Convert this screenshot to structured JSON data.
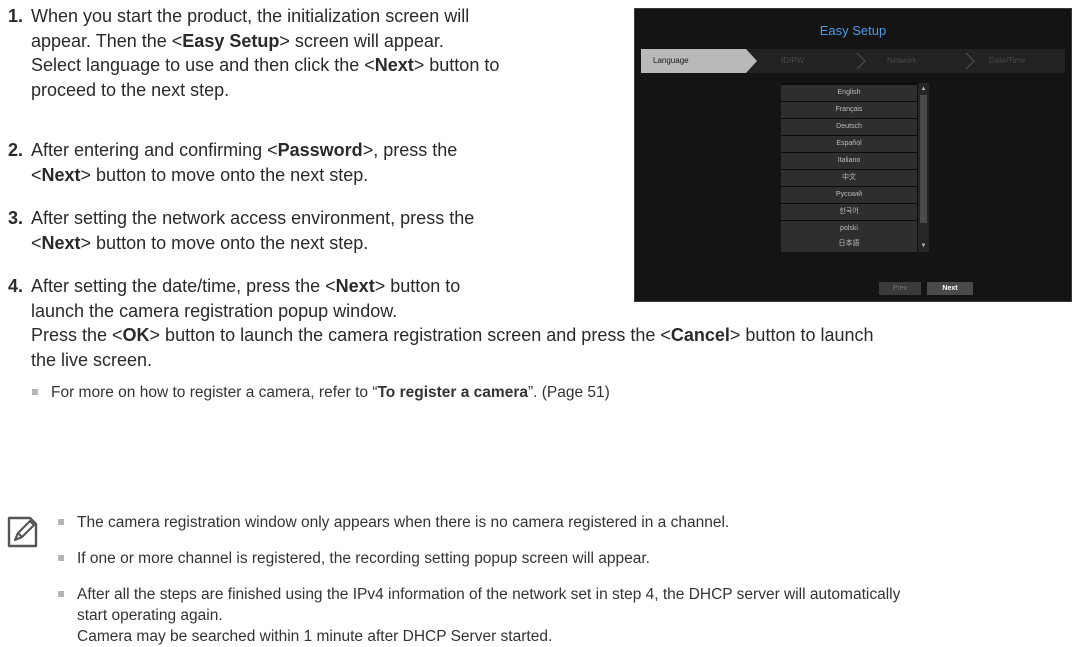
{
  "steps": [
    {
      "num": "1.",
      "lines": [
        {
          "t1": "When you start the product, the initialization screen will"
        },
        {
          "t1": "appear. Then the <",
          "b1": "Easy Setup",
          "t2": "> screen will appear."
        },
        {
          "t1": "Select language to use and then click the <",
          "b1": "Next",
          "t2": "> button to"
        },
        {
          "t1": "proceed to the next step."
        }
      ]
    },
    {
      "num": "2.",
      "lines": [
        {
          "t1": "After entering and confirming <",
          "b1": "Password",
          "t2": ">, press the"
        },
        {
          "t1": "<",
          "b1": "Next",
          "t2": "> button to move onto the next step."
        }
      ]
    },
    {
      "num": "3.",
      "lines": [
        {
          "t1": "After setting the network access environment, press the"
        },
        {
          "t1": "<",
          "b1": "Next",
          "t2": "> button to move onto the next step."
        }
      ]
    },
    {
      "num": "4.",
      "lines": [
        {
          "t1": "After setting the date/time, press the <",
          "b1": "Next",
          "t2": "> button to"
        },
        {
          "t1": "launch the camera registration popup window."
        },
        {
          "t1": "Press the <",
          "b1": "OK",
          "t2": "> button to launch the camera registration screen and press the <",
          "b2": "Cancel",
          "t3": "> button to launch"
        },
        {
          "t1": "the live screen."
        }
      ]
    }
  ],
  "tip": {
    "t1": "For more on how to register a camera, refer to “",
    "b1": "To register a camera",
    "t2": "”. (Page 51)"
  },
  "notes": [
    {
      "lines": [
        "The camera registration window only appears when there is no camera registered in a channel."
      ]
    },
    {
      "lines": [
        "If one or more channel is registered, the recording setting popup screen will appear."
      ]
    },
    {
      "lines": [
        "After all the steps are finished using the IPv4 information of the network set in step 4, the DHCP server will automatically",
        "start operating again.",
        "Camera may be searched within 1 minute after DHCP Server started."
      ]
    }
  ],
  "memo_icon": "memo-pencil-icon",
  "screenshot": {
    "title": "Easy Setup",
    "steps": [
      "Language",
      "ID/PW",
      "Network",
      "Date/Time"
    ],
    "languages": [
      "English",
      "Français",
      "Deutsch",
      "Español",
      "Italiano",
      "中文",
      "Русский",
      "한국어",
      "polski",
      "日本語"
    ],
    "prev_label": "Prev",
    "next_label": "Next",
    "colors": {
      "title": "#4f9ae8",
      "active_step": "#b9b9b9",
      "background": "#141414"
    }
  }
}
